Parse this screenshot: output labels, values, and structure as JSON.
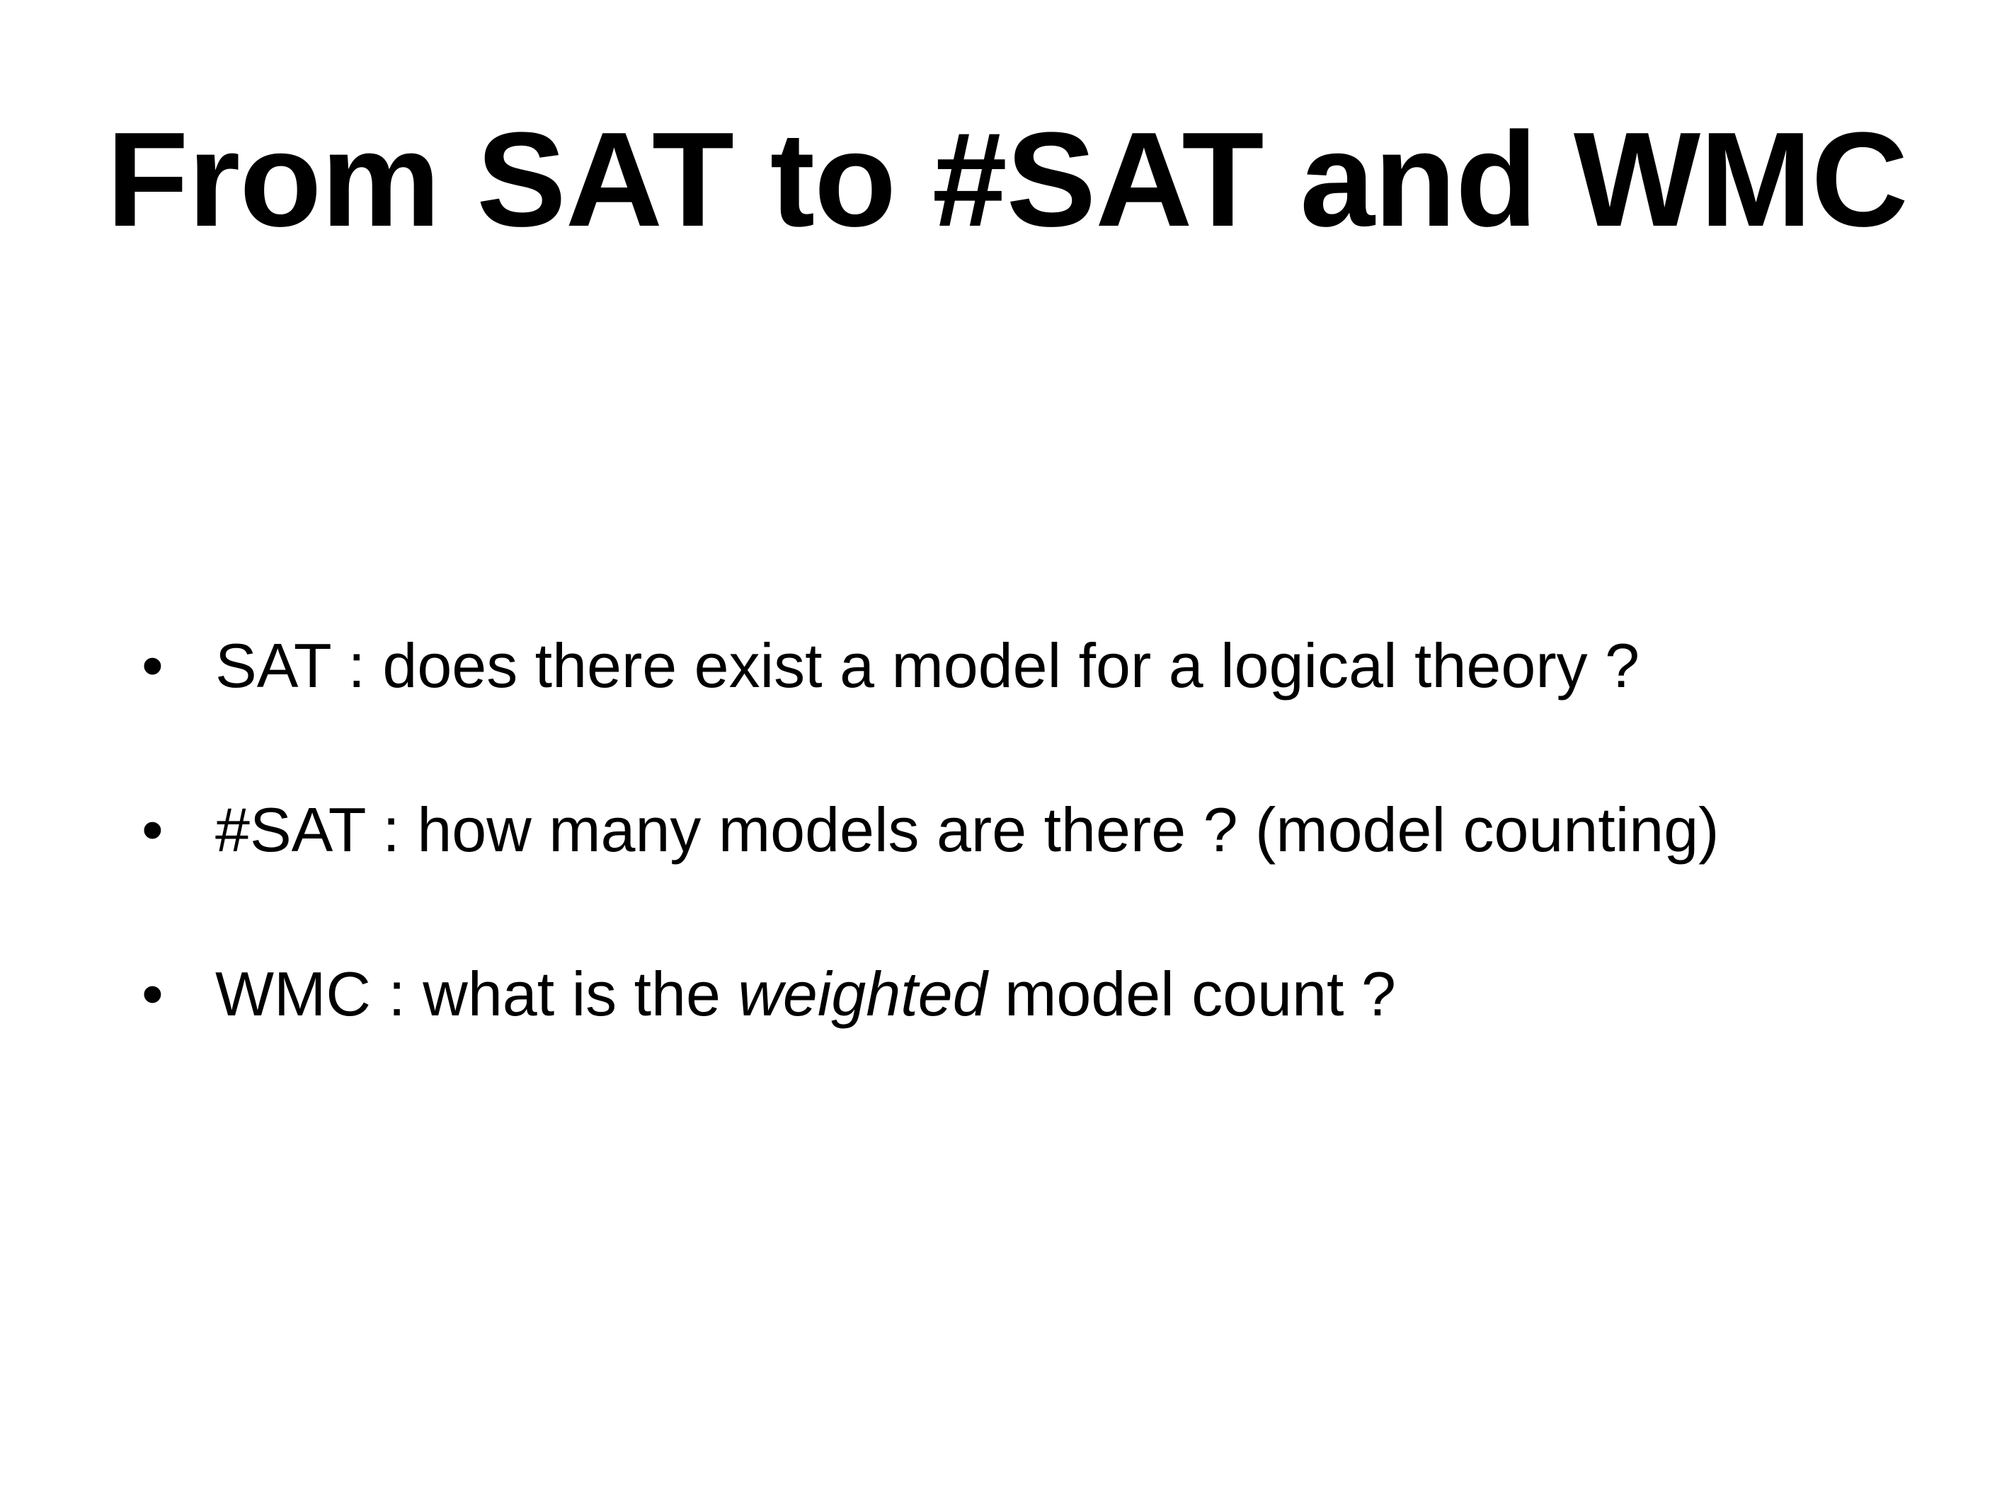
{
  "slide": {
    "title": "From SAT to #SAT and WMC",
    "bullets": [
      {
        "marker": "•",
        "text": "SAT : does there exist a model for a logical theory ?"
      },
      {
        "marker": "•",
        "text": "#SAT : how many models are there ? (model counting)"
      },
      {
        "marker": "•",
        "text_before": "WMC : what is the ",
        "text_emphasis": "weighted",
        "text_after": " model count ?"
      }
    ]
  },
  "colors": {
    "background": "#ffffff",
    "text": "#000000"
  }
}
